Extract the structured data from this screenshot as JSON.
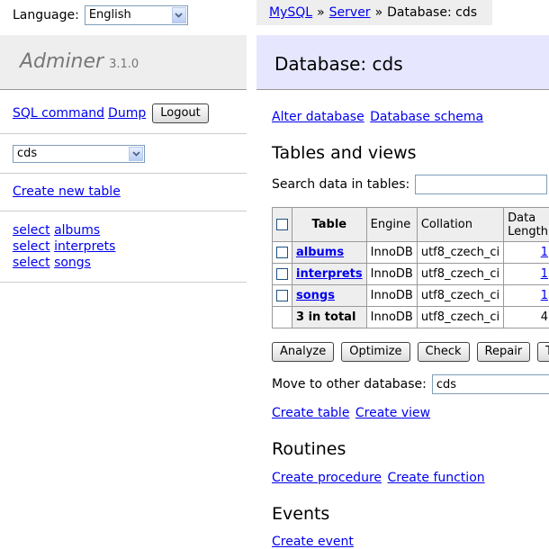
{
  "language": {
    "label": "Language:",
    "value": "English"
  },
  "breadcrumb": {
    "mysql": "MySQL",
    "sep": "»",
    "server": "Server",
    "current": "Database: cds"
  },
  "logo": {
    "name": "Adminer",
    "version": "3.1.0"
  },
  "sidebar": {
    "sql_command": "SQL command",
    "dump": "Dump",
    "logout": "Logout",
    "db_select": "cds",
    "create_table": "Create new table",
    "items": [
      {
        "select": "select",
        "name": "albums"
      },
      {
        "select": "select",
        "name": "interprets"
      },
      {
        "select": "select",
        "name": "songs"
      }
    ]
  },
  "main": {
    "title": "Database: cds",
    "alter": "Alter database",
    "schema": "Database schema",
    "tables_heading": "Tables and views",
    "search_label": "Search data in tables:",
    "search_value": "",
    "columns": {
      "table": "Table",
      "engine": "Engine",
      "collation": "Collation",
      "data_length": "Data Length"
    },
    "rows": [
      {
        "name": "albums",
        "engine": "InnoDB",
        "collation": "utf8_czech_ci",
        "data_length": "1"
      },
      {
        "name": "interprets",
        "engine": "InnoDB",
        "collation": "utf8_czech_ci",
        "data_length": "1"
      },
      {
        "name": "songs",
        "engine": "InnoDB",
        "collation": "utf8_czech_ci",
        "data_length": "1"
      }
    ],
    "total": {
      "name": "3 in total",
      "engine": "InnoDB",
      "collation": "utf8_czech_ci",
      "data_length": "4"
    },
    "buttons": {
      "analyze": "Analyze",
      "optimize": "Optimize",
      "check": "Check",
      "repair": "Repair",
      "truncate": "T"
    },
    "move_label": "Move to other database:",
    "move_value": "cds",
    "create_table": "Create table",
    "create_view": "Create view",
    "routines_heading": "Routines",
    "create_procedure": "Create procedure",
    "create_function": "Create function",
    "events_heading": "Events",
    "create_event": "Create event"
  }
}
